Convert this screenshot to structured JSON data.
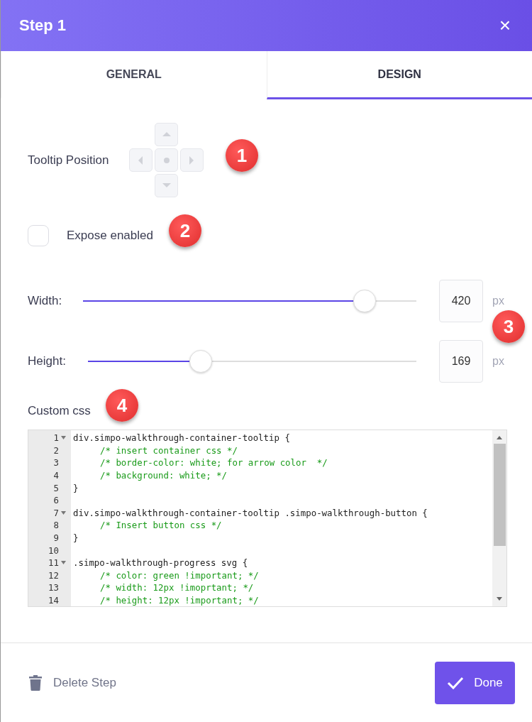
{
  "header": {
    "title": "Step 1",
    "close": "×"
  },
  "tabs": [
    {
      "label": "GENERAL",
      "selected": false
    },
    {
      "label": "DESIGN",
      "selected": true
    }
  ],
  "tooltip_position": {
    "label": "Tooltip Position"
  },
  "expose": {
    "label": "Expose enabled",
    "checked": false
  },
  "sliders": [
    {
      "label": "Width:",
      "level": 0.845,
      "value": "420",
      "unit": "px"
    },
    {
      "label": "Height:",
      "level": 0.344,
      "value": "169",
      "unit": "px"
    }
  ],
  "custom_css": {
    "label": "Custom css",
    "lines": [
      {
        "number": "1",
        "text": "div.simpo-walkthrough-container-tooltip {",
        "kind": "code",
        "fold": true
      },
      {
        "number": "2",
        "text": "/* insert container css */",
        "kind": "comment",
        "fold": false
      },
      {
        "number": "3",
        "text": "/* border-color: white; for arrow color  */",
        "kind": "comment",
        "fold": false
      },
      {
        "number": "4",
        "text": "/* background: white; */",
        "kind": "comment",
        "fold": false
      },
      {
        "number": "5",
        "text": "}",
        "kind": "code",
        "fold": false
      },
      {
        "number": "6",
        "kind": "blank",
        "fold": false
      },
      {
        "number": "7",
        "text": "div.simpo-walkthrough-container-tooltip .simpo-walkthrough-button {",
        "kind": "code",
        "fold": true
      },
      {
        "number": "8",
        "text": "/* Insert button css */",
        "kind": "comment",
        "fold": false
      },
      {
        "number": "9",
        "text": "}",
        "kind": "code",
        "fold": false
      },
      {
        "number": "10",
        "kind": "blank",
        "fold": false
      },
      {
        "number": "11",
        "text": ".simpo-walkthrough-progress svg {",
        "kind": "code",
        "fold": true
      },
      {
        "number": "12",
        "text": "/* color: green !important; */",
        "kind": "comment",
        "fold": false
      },
      {
        "number": "13",
        "text": "/* width: 12px !imoprtant; */",
        "kind": "comment",
        "fold": false
      },
      {
        "number": "14",
        "text": "/* height: 12px !important; */",
        "kind": "comment",
        "fold": false
      }
    ]
  },
  "footer": {
    "delete": "Delete Step",
    "done": "Done"
  },
  "annotations": [
    "1",
    "2",
    "3",
    "4"
  ]
}
